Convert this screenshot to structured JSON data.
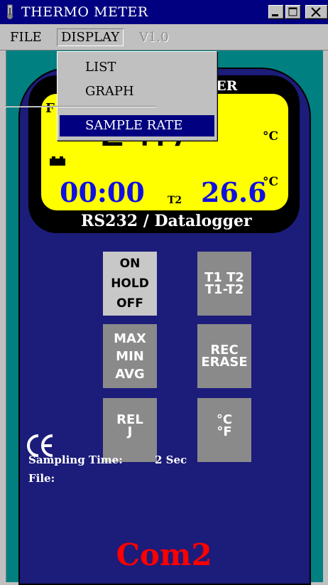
{
  "window": {
    "title": "THERMO METER",
    "icon": "thermometer-icon",
    "controls": [
      "minimize-icon",
      "maximize-icon",
      "close-icon"
    ]
  },
  "menubar": {
    "file": "FILE",
    "display": "DISPLAY",
    "version": "V1.0"
  },
  "display_menu": {
    "items": [
      "LIST",
      "GRAPH",
      "SAMPLE RATE"
    ],
    "highlighted": "SAMPLE RATE"
  },
  "lcd": {
    "title_partial": "TER",
    "left_mark_partial": "F",
    "main_value": "24.7",
    "unit_main": "°C",
    "unit_secondary": "°C",
    "time": "00:00",
    "t2_label": "T2",
    "t2_value": "26.6",
    "battery_icon": "battery-icon",
    "footer": "RS232 / Datalogger"
  },
  "buttons": {
    "power": [
      "ON",
      "HOLD",
      "OFF"
    ],
    "channel": [
      "T1 T2",
      "T1-T2"
    ],
    "stats": [
      "MAX",
      "MIN",
      "AVG"
    ],
    "record": [
      "REC",
      "ERASE"
    ],
    "relative": [
      "REL",
      "J"
    ],
    "units": [
      "°C",
      "°F"
    ]
  },
  "status": {
    "sampling_label": "Sampling Time:",
    "sampling_value": "2 Sec",
    "file_label": "File:",
    "port": "Com2"
  },
  "colors": {
    "title_bar": "#000080",
    "device_body": "#1c1c7a",
    "lcd_background": "#ffff00",
    "lcd_numbers_blue": "#1010e0",
    "port_text": "#ff0000",
    "button_gray": "#8a8a8a",
    "button_light": "#c8c8c8",
    "window_background": "#008080"
  }
}
